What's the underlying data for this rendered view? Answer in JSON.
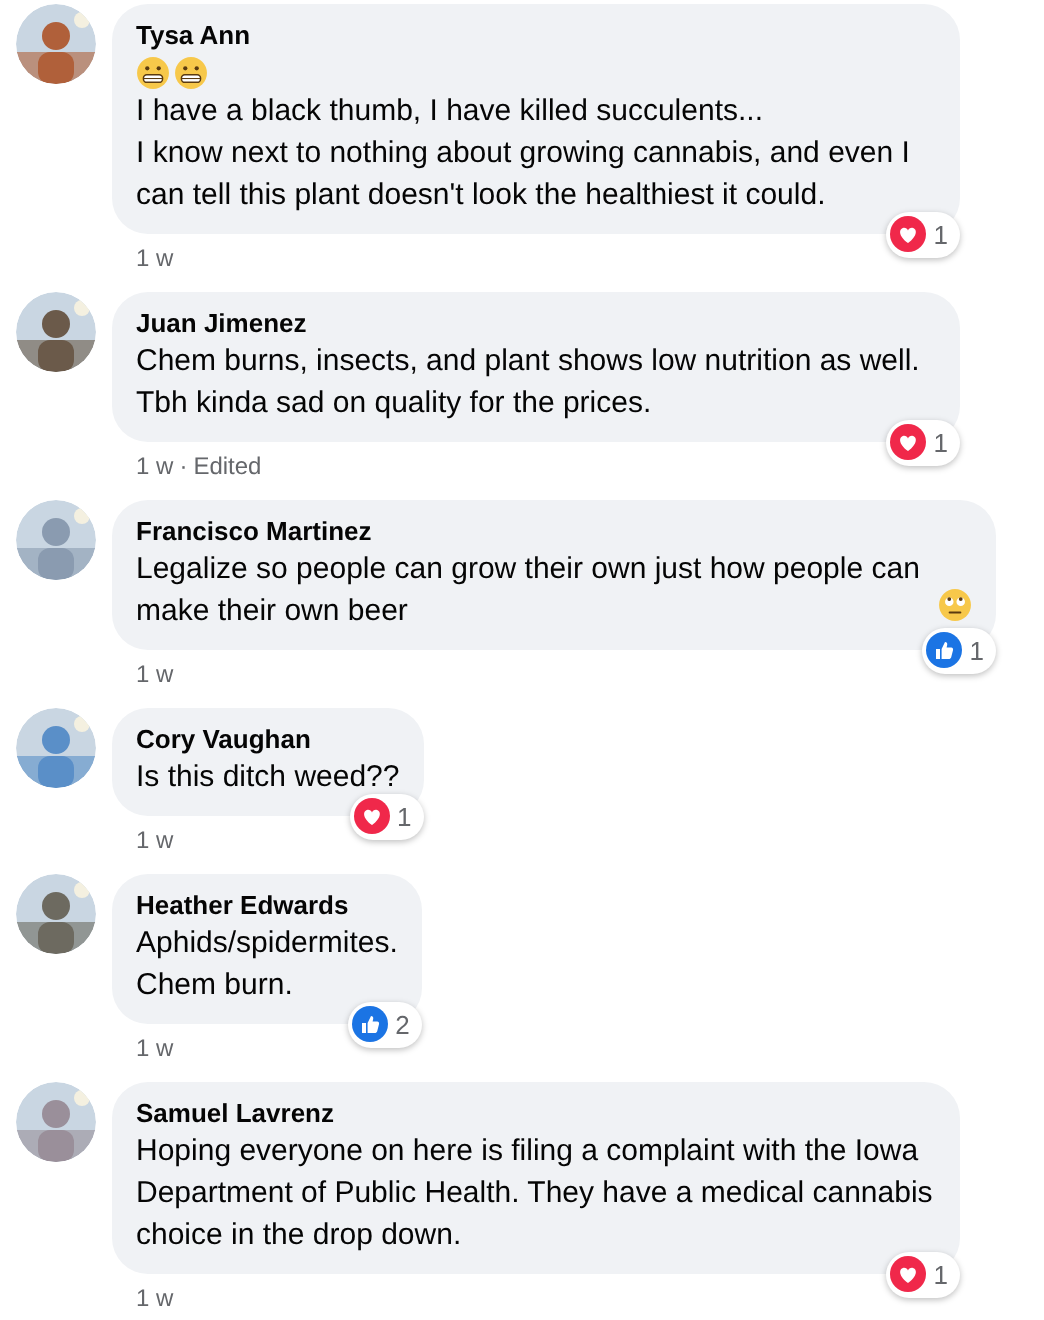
{
  "comments": [
    {
      "author": "Tysa Ann",
      "lead_emojis": [
        {
          "kind": "grimacing"
        },
        {
          "kind": "grimacing"
        }
      ],
      "paragraphs": [
        "I have a black thumb, I have killed succulents...",
        "I know next to nothing about growing cannabis, and even I can tell this plant doesn't look the healthiest it could."
      ],
      "time": "1 w",
      "reaction": {
        "kind": "love",
        "count": "1"
      }
    },
    {
      "author": "Juan Jimenez",
      "paragraphs": [
        "Chem burns, insects, and plant shows low nutrition as well. Tbh kinda sad on quality for the prices."
      ],
      "time": "1 w",
      "separator": "·",
      "edited": "Edited",
      "reaction": {
        "kind": "love",
        "count": "1"
      }
    },
    {
      "author": "Francisco Martinez",
      "paragraphs": [
        "Legalize so people can grow their own just how people can make their own beer"
      ],
      "trail_emoji": {
        "kind": "rolling-eyes"
      },
      "time": "1 w",
      "reaction": {
        "kind": "like",
        "count": "1"
      }
    },
    {
      "author": "Cory Vaughan",
      "paragraphs": [
        "Is this ditch weed??"
      ],
      "time": "1 w",
      "reaction": {
        "kind": "love",
        "count": "1"
      }
    },
    {
      "author": "Heather Edwards",
      "paragraphs": [
        "Aphids/spidermites.",
        "Chem burn."
      ],
      "time": "1 w",
      "reaction": {
        "kind": "like",
        "count": "2"
      }
    },
    {
      "author": "Samuel Lavrenz",
      "paragraphs": [
        "Hoping everyone on here is filing a complaint with the Iowa Department of Public Health. They have a medical cannabis choice in the drop down."
      ],
      "time": "1 w",
      "reaction": {
        "kind": "love",
        "count": "1"
      }
    }
  ]
}
